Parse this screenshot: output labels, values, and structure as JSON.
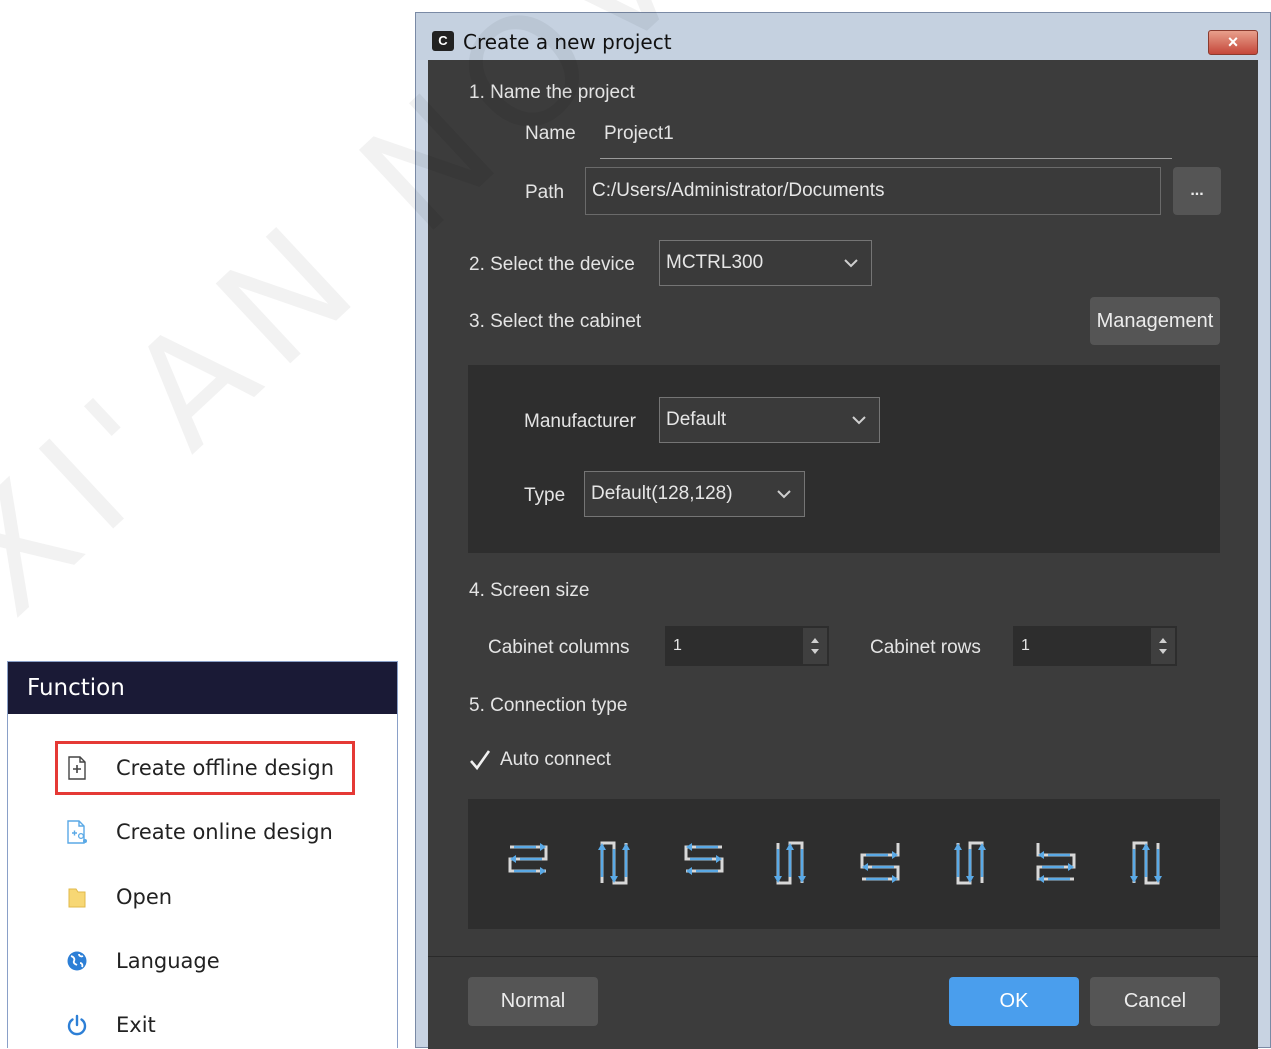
{
  "watermark": "XI'AN NOVASTAR TECH CO., L",
  "function_panel": {
    "title": "Function",
    "items": [
      {
        "label": "Create offline design",
        "icon": "file-plus-icon"
      },
      {
        "label": "Create online design",
        "icon": "file-network-icon"
      },
      {
        "label": "Open",
        "icon": "folder-icon"
      },
      {
        "label": "Language",
        "icon": "globe-icon"
      },
      {
        "label": "Exit",
        "icon": "power-icon"
      }
    ]
  },
  "dialog": {
    "title": "Create a new project",
    "close_label": "×",
    "step1": "1. Name the project",
    "name_label": "Name",
    "name_value": "Project1",
    "path_label": "Path",
    "path_value": "C:/Users/Administrator/Documents",
    "browse_label": "...",
    "step2": "2. Select the device",
    "device_value": "MCTRL300",
    "step3": "3. Select the cabinet",
    "management_label": "Management",
    "manufacturer_label": "Manufacturer",
    "manufacturer_value": "Default",
    "type_label": "Type",
    "type_value": "Default(128,128)",
    "step4": "4. Screen size",
    "columns_label": "Cabinet columns",
    "columns_value": "1",
    "rows_label": "Cabinet rows",
    "rows_value": "1",
    "step5": "5. Connection type",
    "auto_connect_label": "Auto connect",
    "auto_connect_checked": true,
    "normal_label": "Normal",
    "ok_label": "OK",
    "cancel_label": "Cancel"
  },
  "colors": {
    "accent": "#4a9eed",
    "dialog_bg": "#3c3c3c",
    "highlight_border": "#e53935",
    "icon_blue": "#5aa9e6"
  }
}
